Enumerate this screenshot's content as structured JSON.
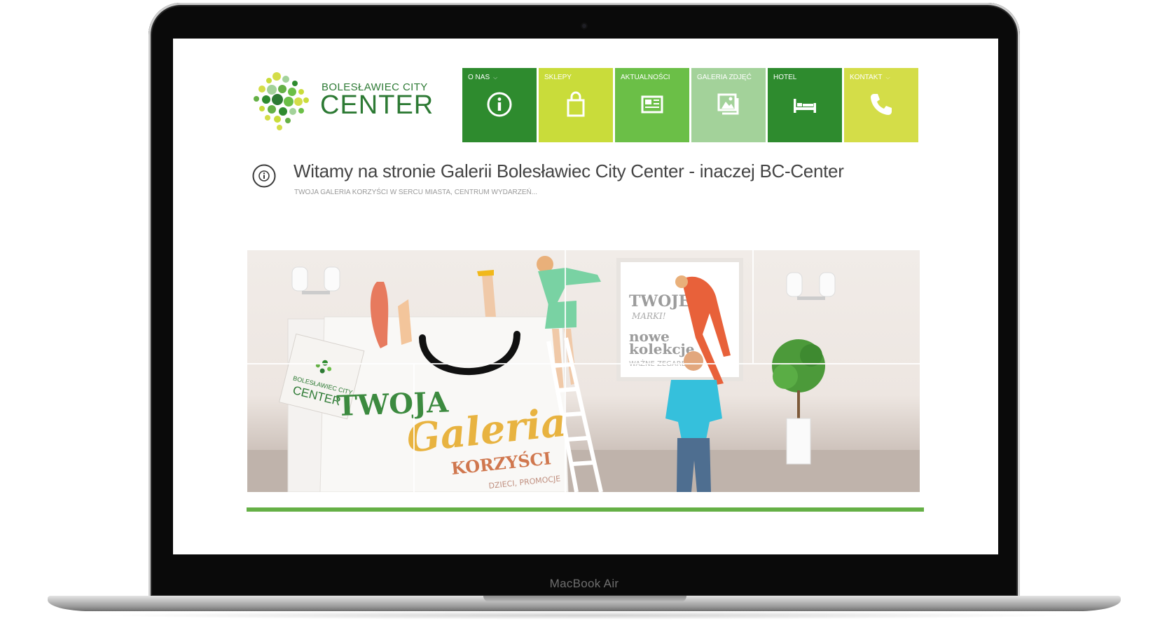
{
  "device": {
    "label": "MacBook Air"
  },
  "logo": {
    "line1": "BOLESŁAWIEC CITY",
    "line2": "CENTER"
  },
  "nav": {
    "items": [
      {
        "label": "O NAS",
        "icon": "info-icon",
        "color": "#2e8b2e",
        "dropdown": true
      },
      {
        "label": "SKLEPY",
        "icon": "shopping-bag-icon",
        "color": "#c9dc3a",
        "dropdown": false
      },
      {
        "label": "AKTUALNOŚCI",
        "icon": "newspaper-icon",
        "color": "#6bbf47",
        "dropdown": false
      },
      {
        "label": "GALERIA ZDJĘĆ",
        "icon": "photo-gallery-icon",
        "color": "#a3d29a",
        "dropdown": false
      },
      {
        "label": "HOTEL",
        "icon": "bed-icon",
        "color": "#2e8b2e",
        "dropdown": false
      },
      {
        "label": "KONTAKT",
        "icon": "phone-icon",
        "color": "#d4dd48",
        "dropdown": true
      }
    ]
  },
  "welcome": {
    "title": "Witamy na stronie Galerii Bolesławiec City Center - inaczej BC-Center",
    "subtitle": "TWOJA GALERIA KORZYŚCI W SERCU MIASTA, CENTRUM WYDARZEŃ..."
  },
  "banner": {
    "bag_text_1": "TWOJA",
    "bag_text_2": "Galeria",
    "bag_text_3": "KORZYŚCI",
    "bag_text_4": "DZIECI, PROMOCJE",
    "tag_line1": "BOLESŁAWIEC CITY",
    "tag_line2": "CENTER",
    "poster_line1": "TWOJE",
    "poster_line2": "MARKI!",
    "poster_line3": "nowe",
    "poster_line4": "kolekcje",
    "poster_line5": "WAŻNE ZEGARE"
  },
  "colors": {
    "brand_dark_green": "#2d7a34",
    "accent_green": "#65b046",
    "lime": "#c9dc3a"
  }
}
